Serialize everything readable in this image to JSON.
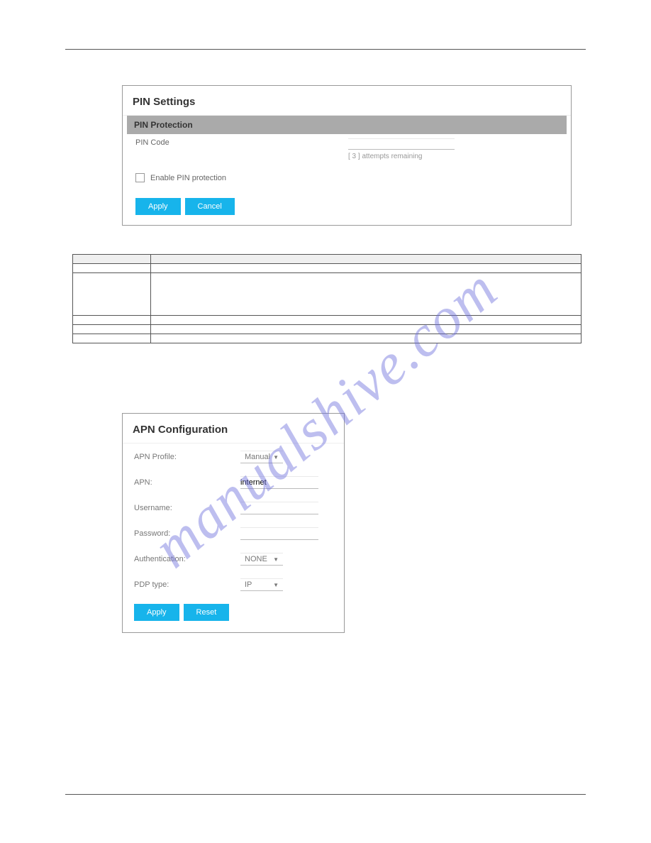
{
  "header": {
    "left": "",
    "right": ""
  },
  "watermark": "manualshive.com",
  "pin_panel": {
    "title": "PIN Settings",
    "section": "PIN Protection",
    "pin_label": "PIN Code",
    "pin_value": "",
    "attempts_hint": "[ 3 ] attempts remaining",
    "enable_label": "Enable PIN protection",
    "apply": "Apply",
    "cancel": "Cancel"
  },
  "table_intro": "",
  "spec_table": {
    "head": {
      "label": "",
      "desc": ""
    },
    "rows": [
      {
        "label": "",
        "desc": ""
      },
      {
        "label": "",
        "desc": ""
      },
      {
        "label": "",
        "desc": ""
      },
      {
        "label": "",
        "desc": ""
      },
      {
        "label": "",
        "desc": ""
      }
    ]
  },
  "sec": {
    "num": "",
    "body1": "",
    "body2": ""
  },
  "apn_panel": {
    "title": "APN Configuration",
    "profile_label": "APN Profile:",
    "profile_value": "Manual",
    "apn_label": "APN:",
    "apn_value": "internet",
    "username_label": "Username:",
    "username_value": "",
    "password_label": "Password:",
    "password_value": "",
    "auth_label": "Authentication:",
    "auth_value": "NONE",
    "pdp_label": "PDP type:",
    "pdp_value": "IP",
    "apply": "Apply",
    "reset": "Reset"
  },
  "footer": {
    "left": "",
    "right": ""
  }
}
